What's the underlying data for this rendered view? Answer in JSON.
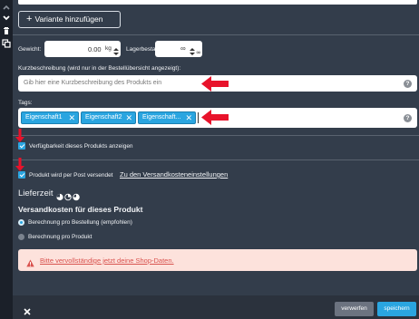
{
  "sidebar": {
    "icons": [
      "chevron-up-icon",
      "chevron-down-icon",
      "trash-icon",
      "copy-icon"
    ]
  },
  "variant": {
    "add_label": "Variante hinzufügen"
  },
  "weight": {
    "label": "Gewicht:",
    "value": "0.00",
    "unit": "kg"
  },
  "stock": {
    "label": "Lagerbestand:",
    "value": "∞"
  },
  "short_description": {
    "label": "Kurzbeschreibung (wird nur in der Bestellübersicht angezeigt):",
    "placeholder": "Gib hier eine Kurzbeschreibung des Produkts ein"
  },
  "tags": {
    "label": "Tags:",
    "items": [
      "Eigenschaft1",
      "Eigenschaft2",
      "Eigenschaft..."
    ]
  },
  "availability": {
    "label": "Verfügbarkeit dieses Produkts anzeigen",
    "checked": true
  },
  "shipping": {
    "label": "Produkt wird per Post versendet",
    "checked": true,
    "link": "Zu den Versandkosteneinstellungen"
  },
  "delivery": {
    "label": "Lieferzeit"
  },
  "shipping_costs": {
    "title": "Versandkosten für dieses Produkt",
    "options": [
      {
        "label": "Berechnung pro Bestellung (empfohlen)",
        "selected": true
      },
      {
        "label": "Berechnung pro Produkt",
        "selected": false
      }
    ]
  },
  "warning": {
    "text": "Bitte vervollständige jetzt deine Shop-Daten."
  },
  "footer": {
    "discard_label": "verwerfen",
    "save_label": "speichern"
  },
  "colors": {
    "accent": "#2aa5e0",
    "arrow": "#e8132b",
    "warning_text": "#d9534f"
  }
}
